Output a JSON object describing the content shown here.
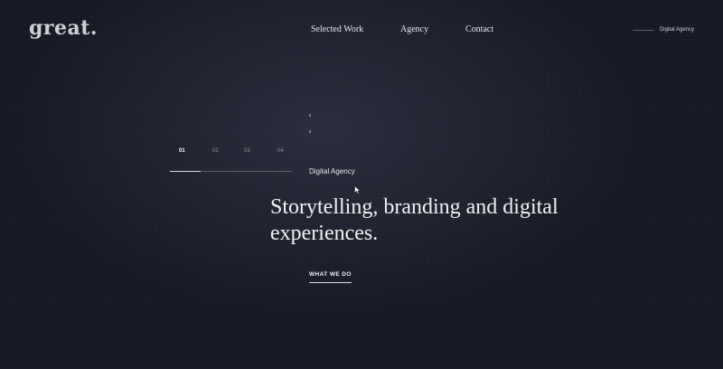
{
  "brand": {
    "logo": "great."
  },
  "nav": {
    "items": [
      {
        "label": "Selected Work"
      },
      {
        "label": "Agency"
      },
      {
        "label": "Contact"
      }
    ]
  },
  "header": {
    "tagline": "Digital Agency"
  },
  "slider": {
    "arrows": {
      "up": "‹",
      "down": "›"
    },
    "slides": [
      {
        "label": "01"
      },
      {
        "label": "02"
      },
      {
        "label": "03"
      },
      {
        "label": "04"
      }
    ],
    "active_index": 0,
    "subtitle": "Digital Agency"
  },
  "hero": {
    "headline": "Storytelling, branding and digital experiences.",
    "cta_label": "WHAT WE DO"
  },
  "colors": {
    "background": "#171a26",
    "text": "#e9e9ec"
  },
  "icons": {
    "cursor": "mouse-pointer-icon"
  }
}
